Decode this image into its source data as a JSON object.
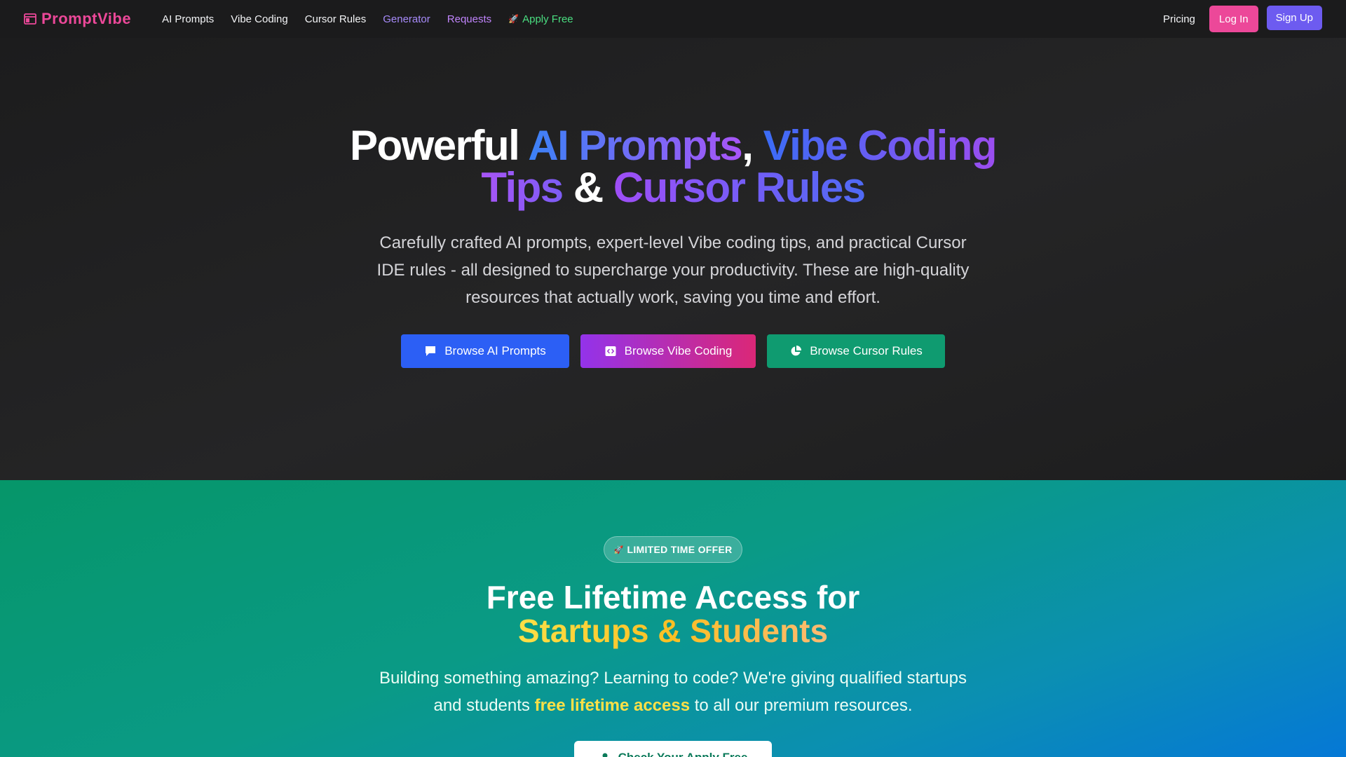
{
  "nav": {
    "logo": "PromptVibe",
    "links": [
      {
        "label": "AI Prompts",
        "icon": ""
      },
      {
        "label": "Vibe Coding",
        "icon": ""
      },
      {
        "label": "Cursor Rules",
        "icon": ""
      },
      {
        "label": "Generator",
        "icon": ""
      },
      {
        "label": "Requests",
        "icon": ""
      },
      {
        "label": "Apply Free",
        "icon": "rocket-icon"
      }
    ],
    "pricing": "Pricing",
    "login": "Log In",
    "signup": "Sign Up"
  },
  "hero": {
    "title_word1": "Powerful ",
    "title_ai_prompts": "AI Prompts",
    "title_comma": ", ",
    "title_vibe_coding": "Vibe Coding",
    "title_tips": "Tips",
    "title_amp": " & ",
    "title_cursor_rules": "Cursor Rules",
    "subtitle": "Carefully crafted AI prompts, expert-level Vibe coding tips, and practical Cursor IDE rules - all designed to supercharge your productivity. These are high-quality resources that actually work, saving you time and effort.",
    "buttons": [
      {
        "label": "Browse AI Prompts",
        "icon": "chat-bubble-icon"
      },
      {
        "label": "Browse Vibe Coding",
        "icon": "code-icon"
      },
      {
        "label": "Browse Cursor Rules",
        "icon": "pie-chart-icon"
      }
    ]
  },
  "offer": {
    "badge": "LIMITED TIME OFFER",
    "badge_icon": "rocket-icon",
    "title_line1": "Free Lifetime Access for",
    "title_line2": "Startups & Students",
    "subtitle_before": "Building something amazing? Learning to code? We're giving qualified startups and students ",
    "subtitle_highlight": "free lifetime access",
    "subtitle_after": " to all our premium resources.",
    "cta": "Check Your Apply Free",
    "cta_icon": "user-icon"
  },
  "colors": {
    "brand_pink": "#ec4899",
    "signup_purple": "#6d5bf0",
    "blue_button": "#2c5ff5",
    "green_button": "#0f9b70",
    "highlight_yellow": "#fde047"
  }
}
